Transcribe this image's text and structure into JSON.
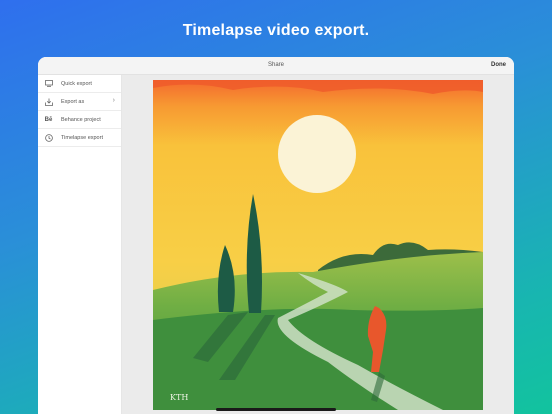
{
  "headline": "Timelapse video export.",
  "topbar": {
    "title": "Share",
    "done_label": "Done"
  },
  "sidebar": {
    "items": [
      {
        "label": "Quick export",
        "icon": "monitor-icon"
      },
      {
        "label": "Export as",
        "icon": "download-icon",
        "has_chevron": true
      },
      {
        "label": "Behance project",
        "icon": "behance-icon"
      },
      {
        "label": "Timelapse export",
        "icon": "clock-icon"
      }
    ]
  },
  "artwork": {
    "signature": "KTH"
  },
  "colors": {
    "background_start": "#2f6fee",
    "background_end": "#12c39e",
    "sky": "#f8c53a",
    "field": "#4e9b40",
    "sun": "#fbf3d6",
    "figure": "#e8572c"
  }
}
